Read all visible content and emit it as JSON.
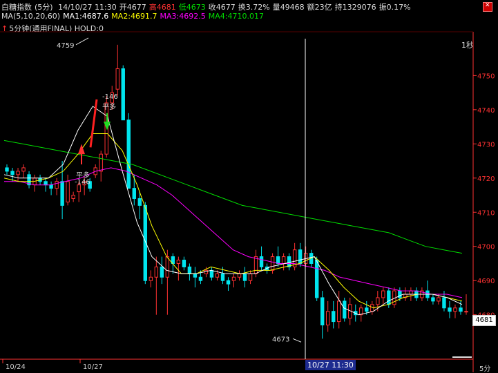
{
  "header": {
    "name": "白糖指数",
    "period": "(5分)",
    "datetime": "14/10/27 11:30",
    "open": "开4677",
    "high": "高4681",
    "low": "低4673",
    "close": "收4677",
    "turnover": "换3.72%",
    "volume": "量49468",
    "amount": "额23亿",
    "hold": "持1329076",
    "amplitude": "振0.17%"
  },
  "ma": {
    "params": "MA(5,10,20,60)",
    "ma1": "MA1:4687.6",
    "ma2": "MA2:4691.7",
    "ma3": "MA3:4692.5",
    "ma4": "MA4:4710.017"
  },
  "indicator": {
    "arrow": "↑",
    "label": "5分钟(通用FINAL) HOLD:0"
  },
  "refresh_label": "1秒",
  "current_price": "4681",
  "cursor_time": "10/27 11:30",
  "period_label": "5分",
  "colors": {
    "up": "#ff3232",
    "down": "#00e5ee",
    "ma1": "#ffffff",
    "ma2": "#ffff00",
    "ma3": "#ff00ff",
    "ma4": "#00dd00",
    "axis": "#ff3232"
  },
  "chart_data": {
    "type": "candlestick",
    "ylim": [
      4667,
      4762
    ],
    "y_ticks": [
      4680,
      4690,
      4700,
      4710,
      4720,
      4730,
      4740,
      4750
    ],
    "x_labels": [
      "10/24",
      "10/27"
    ],
    "annotations": [
      {
        "text": "4759",
        "value": 4759
      },
      {
        "text": "4673",
        "value": 4673
      },
      {
        "text": "-146",
        "value": 4744
      },
      {
        "text": "平多",
        "value": 4741
      },
      {
        "text": "平多",
        "value": 4721
      },
      {
        "text": "-146",
        "value": 4719
      }
    ],
    "candles": [
      [
        4723,
        4724,
        4721,
        4722
      ],
      [
        4722,
        4723,
        4719,
        4721
      ],
      [
        4721,
        4723,
        4719,
        4722
      ],
      [
        4722,
        4724,
        4720,
        4723
      ],
      [
        4721,
        4722,
        4717,
        4718
      ],
      [
        4718,
        4721,
        4716,
        4720
      ],
      [
        4720,
        4721,
        4718,
        4719
      ],
      [
        4719,
        4720,
        4716,
        4718
      ],
      [
        4718,
        4719,
        4715,
        4717
      ],
      [
        4717,
        4720,
        4715,
        4719
      ],
      [
        4719,
        4725,
        4708,
        4712
      ],
      [
        4713,
        4721,
        4712,
        4719
      ],
      [
        4714,
        4716,
        4713,
        4715
      ],
      [
        4716,
        4719,
        4713,
        4718
      ],
      [
        4718,
        4720,
        4715,
        4719
      ],
      [
        4719,
        4720,
        4716,
        4717
      ],
      [
        4721,
        4724,
        4720,
        4723
      ],
      [
        4722,
        4728,
        4719,
        4727
      ],
      [
        4727,
        4744,
        4726,
        4742
      ],
      [
        4742,
        4747,
        4740,
        4745
      ],
      [
        4746,
        4759,
        4744,
        4752
      ],
      [
        4752,
        4753,
        4737,
        4737
      ],
      [
        4737,
        4739,
        4717,
        4717
      ],
      [
        4717,
        4721,
        4712,
        4714
      ],
      [
        4714,
        4716,
        4708,
        4712
      ],
      [
        4712,
        4713,
        4689,
        4690
      ],
      [
        4690,
        4693,
        4688,
        4691
      ],
      [
        4691,
        4697,
        4680,
        4694
      ],
      [
        4694,
        4697,
        4689,
        4691
      ],
      [
        4691,
        4699,
        4680,
        4697
      ],
      [
        4697,
        4698,
        4692,
        4695
      ],
      [
        4695,
        4697,
        4690,
        4696
      ],
      [
        4696,
        4697,
        4693,
        4694
      ],
      [
        4694,
        4695,
        4690,
        4692
      ],
      [
        4692,
        4694,
        4688,
        4691
      ],
      [
        4691,
        4693,
        4689,
        4690
      ],
      [
        4692,
        4694,
        4691,
        4693
      ],
      [
        4693,
        4694,
        4690,
        4691
      ],
      [
        4691,
        4693,
        4690,
        4692
      ],
      [
        4692,
        4694,
        4689,
        4690
      ],
      [
        4690,
        4691,
        4687,
        4689
      ],
      [
        4690,
        4692,
        4688,
        4691
      ],
      [
        4691,
        4693,
        4690,
        4692
      ],
      [
        4692,
        4694,
        4688,
        4690
      ],
      [
        4690,
        4693,
        4689,
        4692
      ],
      [
        4692,
        4699,
        4691,
        4697
      ],
      [
        4697,
        4700,
        4693,
        4694
      ],
      [
        4694,
        4695,
        4692,
        4693
      ],
      [
        4693,
        4698,
        4692,
        4697
      ],
      [
        4697,
        4700,
        4694,
        4695
      ],
      [
        4695,
        4698,
        4693,
        4697
      ],
      [
        4697,
        4698,
        4693,
        4694
      ],
      [
        4694,
        4701,
        4693,
        4699
      ],
      [
        4699,
        4701,
        4694,
        4695
      ],
      [
        4695,
        4700,
        4694,
        4698
      ],
      [
        4698,
        4699,
        4694,
        4695
      ],
      [
        4696,
        4697,
        4684,
        4685
      ],
      [
        4685,
        4687,
        4673,
        4677
      ],
      [
        4677,
        4684,
        4675,
        4681
      ],
      [
        4681,
        4684,
        4676,
        4678
      ],
      [
        4678,
        4687,
        4676,
        4684
      ],
      [
        4684,
        4685,
        4678,
        4679
      ],
      [
        4679,
        4685,
        4677,
        4683
      ],
      [
        4681,
        4683,
        4678,
        4680
      ],
      [
        4680,
        4683,
        4678,
        4682
      ],
      [
        4682,
        4684,
        4680,
        4681
      ],
      [
        4681,
        4684,
        4680,
        4683
      ],
      [
        4683,
        4687,
        4681,
        4685
      ],
      [
        4685,
        4688,
        4683,
        4687
      ],
      [
        4687,
        4688,
        4682,
        4683
      ],
      [
        4683,
        4688,
        4682,
        4687
      ],
      [
        4687,
        4688,
        4684,
        4685
      ],
      [
        4685,
        4688,
        4684,
        4686
      ],
      [
        4686,
        4688,
        4684,
        4687
      ],
      [
        4687,
        4688,
        4684,
        4685
      ],
      [
        4685,
        4688,
        4684,
        4687
      ],
      [
        4687,
        4690,
        4684,
        4685
      ],
      [
        4685,
        4686,
        4683,
        4684
      ],
      [
        4684,
        4686,
        4683,
        4685
      ],
      [
        4685,
        4687,
        4681,
        4682
      ],
      [
        4682,
        4684,
        4679,
        4681
      ],
      [
        4681,
        4683,
        4679,
        4682
      ],
      [
        4682,
        4684,
        4680,
        4681
      ],
      [
        4681,
        4686,
        4680,
        4681
      ]
    ],
    "ma4_points": [
      4731,
      4730,
      4729,
      4728,
      4727,
      4726,
      4725,
      4724,
      4722,
      4720,
      4718,
      4716,
      4714,
      4712,
      4711,
      4710,
      4709,
      4708,
      4707,
      4706,
      4705,
      4704,
      4702,
      4700,
      4699,
      4698
    ],
    "ma3_points": [
      4719,
      4719,
      4718,
      4718,
      4719,
      4720,
      4722,
      4723,
      4722,
      4720,
      4718,
      4715,
      4711,
      4707,
      4703,
      4699,
      4697,
      4696,
      4695,
      4695,
      4694,
      4693,
      4691,
      4690,
      4689,
      4688,
      4687,
      4687,
      4686,
      4686,
      4685
    ],
    "ma2_points": [
      4720,
      4719,
      4719,
      4720,
      4722,
      4727,
      4733,
      4733,
      4728,
      4718,
      4706,
      4697,
      4692,
      4692,
      4694,
      4693,
      4692,
      4693,
      4693,
      4694,
      4695,
      4697,
      4693,
      4688,
      4684,
      4682,
      4683,
      4685,
      4686,
      4686,
      4685,
      4684
    ],
    "ma1_points": [
      4721,
      4720,
      4720,
      4720,
      4724,
      4734,
      4741,
      4738,
      4722,
      4707,
      4697,
      4693,
      4692,
      4692,
      4693,
      4692,
      4692,
      4692,
      4694,
      4695,
      4696,
      4697,
      4689,
      4682,
      4680,
      4681,
      4684,
      4686,
      4686,
      4686,
      4685,
      4683
    ]
  }
}
